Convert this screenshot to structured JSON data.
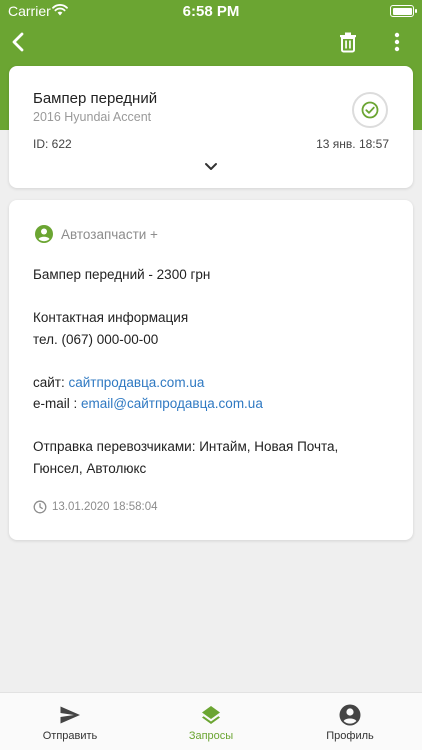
{
  "status_bar": {
    "carrier": "Carrier",
    "time": "6:58 PM"
  },
  "colors": {
    "brand_green": "#6ba532",
    "link_blue": "#2f79c2",
    "background": "#efefef"
  },
  "header": {
    "back_icon": "chevron-left-icon",
    "trash_icon": "trash-icon",
    "more_icon": "more-vertical-icon"
  },
  "request": {
    "title": "Бампер передний",
    "car": "2016 Hyundai Accent",
    "id_label": "ID: 622",
    "date": "13 янв. 18:57",
    "status_icon": "check-circle-icon",
    "expand_icon": "chevron-down-icon"
  },
  "reply": {
    "seller_icon": "account-circle-icon",
    "seller_name": "Автозапчасти +",
    "line_price": "Бампер передний - 2300 грн",
    "contact_header": "Контактная информация",
    "phone": "тел. (067) 000-00-00",
    "site_label": "сайт:",
    "site_link": "сайтпродавца.com.ua",
    "email_label": "e-mail :",
    "email_link": "email@сайтпродавца.com.ua",
    "shipping_line1": "Отправка перевозчиками: Интайм, Новая Почта,",
    "shipping_line2": "Гюнсел, Автолюкс",
    "timestamp": "13.01.2020 18:58:04",
    "clock_icon": "clock-icon"
  },
  "tabbar": {
    "active": "requests",
    "tabs": [
      {
        "key": "send",
        "label": "Отправить",
        "icon": "send-icon"
      },
      {
        "key": "requests",
        "label": "Запросы",
        "icon": "layers-icon"
      },
      {
        "key": "profile",
        "label": "Профиль",
        "icon": "account-circle-icon"
      }
    ]
  }
}
